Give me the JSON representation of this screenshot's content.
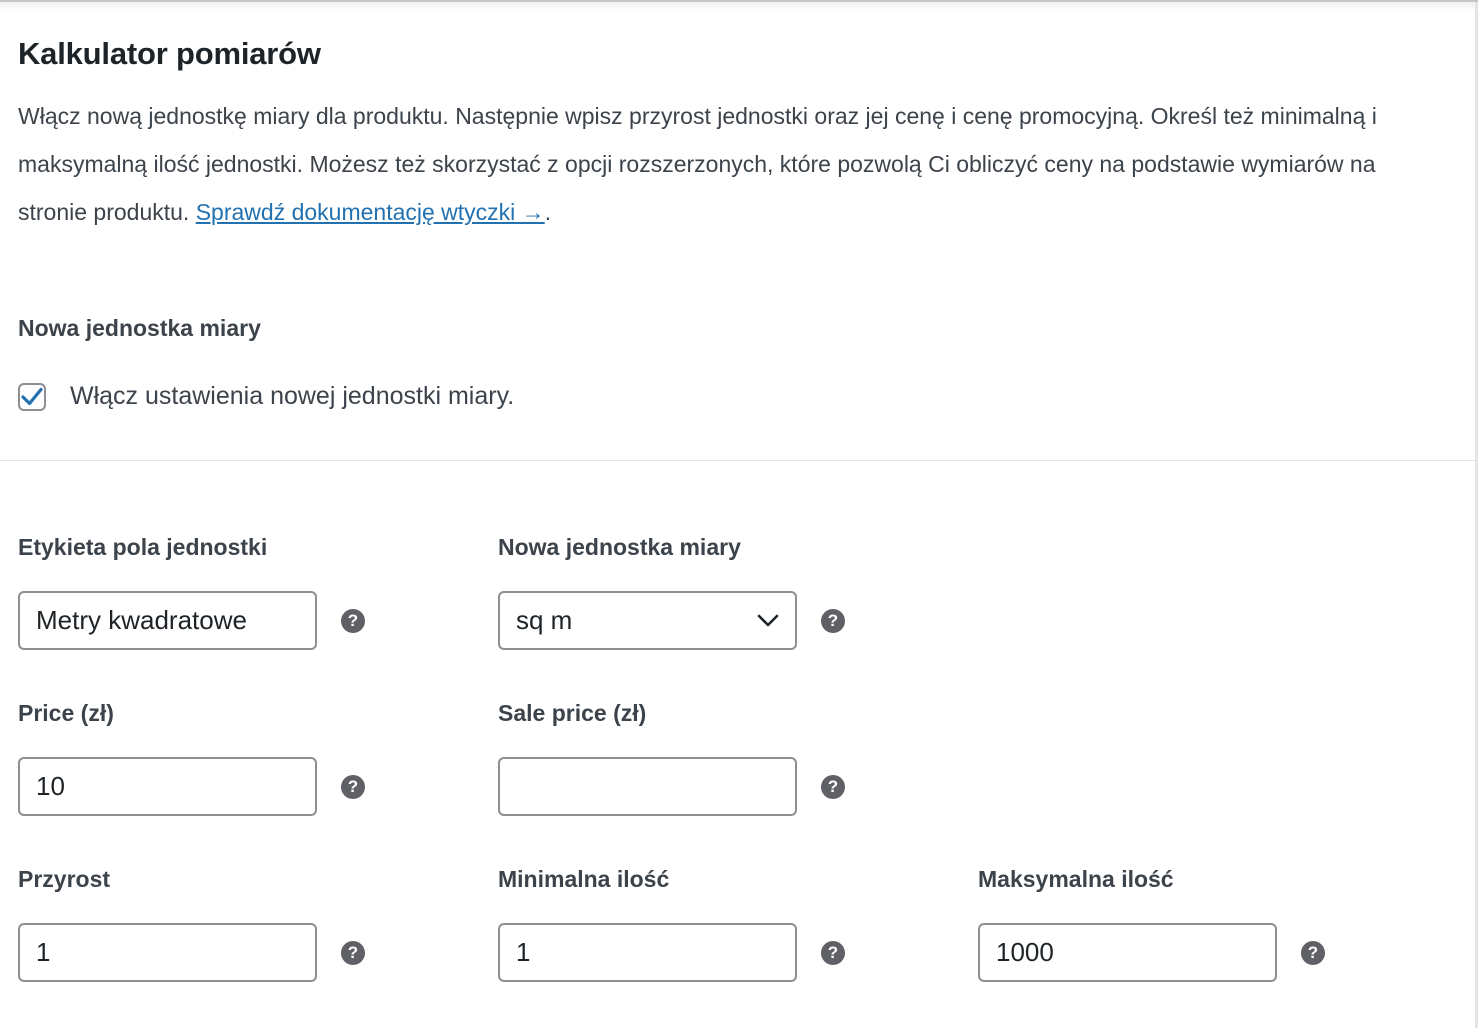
{
  "panel": {
    "title": "Kalkulator pomiarów",
    "description": "Włącz nową jednostkę miary dla produktu. Następnie wpisz przyrost jednostki oraz jej cenę i cenę promocyjną. Określ też minimalną i maksymalną ilość jednostki. Możesz też skorzystać z opcji rozszerzonych, które pozwolą Ci obliczyć ceny na podstawie wymiarów na stronie produktu.",
    "doc_link": "Sprawdź dokumentację wtyczki →",
    "doc_link_suffix": "."
  },
  "enable_section": {
    "label": "Nowa jednostka miary",
    "checkbox_label": "Włącz ustawienia nowej jednostki miary.",
    "checked": true
  },
  "fields": {
    "unit_label": {
      "label": "Etykieta pola jednostki",
      "value": "Metry kwadratowe",
      "help": "?"
    },
    "unit": {
      "label": "Nowa jednostka miary",
      "value": "sq m",
      "help": "?"
    },
    "price": {
      "label": "Price (zł)",
      "value": "10",
      "help": "?"
    },
    "sale_price": {
      "label": "Sale price (zł)",
      "value": "",
      "help": "?"
    },
    "increment": {
      "label": "Przyrost",
      "value": "1",
      "help": "?"
    },
    "min_qty": {
      "label": "Minimalna ilość",
      "value": "1",
      "help": "?"
    },
    "max_qty": {
      "label": "Maksymalna ilość",
      "value": "1000",
      "help": "?"
    }
  },
  "colors": {
    "link": "#2271b1",
    "checkbox_check": "#2271b1",
    "help_icon": "#5f6166",
    "input_border": "#8c8f94"
  }
}
